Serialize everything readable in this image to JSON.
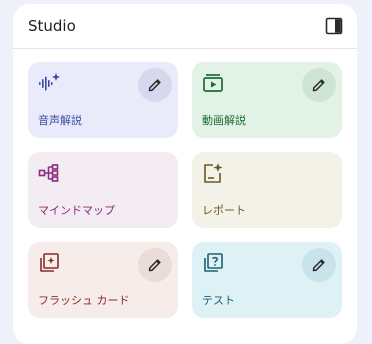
{
  "header": {
    "title": "Studio"
  },
  "cards": [
    {
      "label": "音声解説",
      "icon": "audio-waveform-sparkle-icon",
      "color": "#3b4aa8",
      "has_edit": true
    },
    {
      "label": "動画解説",
      "icon": "video-slideshow-icon",
      "color": "#1e6b36",
      "has_edit": true
    },
    {
      "label": "マインドマップ",
      "icon": "mind-map-icon",
      "color": "#8a2a7a",
      "has_edit": false
    },
    {
      "label": "レポート",
      "icon": "report-sparkle-icon",
      "color": "#6b5a20",
      "has_edit": false
    },
    {
      "label": "フラッシュ カード",
      "icon": "flashcards-icon",
      "color": "#8a2a2a",
      "has_edit": true
    },
    {
      "label": "テスト",
      "icon": "quiz-icon",
      "color": "#1f5f75",
      "has_edit": true
    }
  ]
}
